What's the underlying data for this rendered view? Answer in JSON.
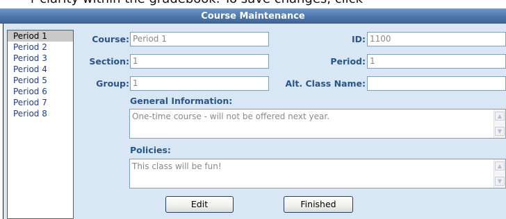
{
  "intro_text": "r clarity within the gradebook. To save changes, click",
  "title": "Course Maintenance",
  "periods": [
    "Period 1",
    "Period 2",
    "Period 3",
    "Period 4",
    "Period 5",
    "Period 6",
    "Period 7",
    "Period 8"
  ],
  "selected_period": "Period 1",
  "form": {
    "course_label": "Course:",
    "course_value": "Period 1",
    "id_label": "ID:",
    "id_value": "1100",
    "section_label": "Section:",
    "section_value": "1",
    "period_label": "Period:",
    "period_value": "1",
    "group_label": "Group:",
    "group_value": "1",
    "alt_class_label": "Alt. Class Name:",
    "alt_class_value": "",
    "general_info_label": "General Information:",
    "general_info_value": "One-time course - will not be offered next year.",
    "policies_label": "Policies:",
    "policies_value": "This class will be fun!"
  },
  "buttons": {
    "edit": "Edit",
    "finished": "Finished"
  },
  "colors": {
    "title_bar": "#4f77ad",
    "panel_bg": "#d9e6f3",
    "label": "#27568a",
    "list_text": "#1d3f95"
  }
}
